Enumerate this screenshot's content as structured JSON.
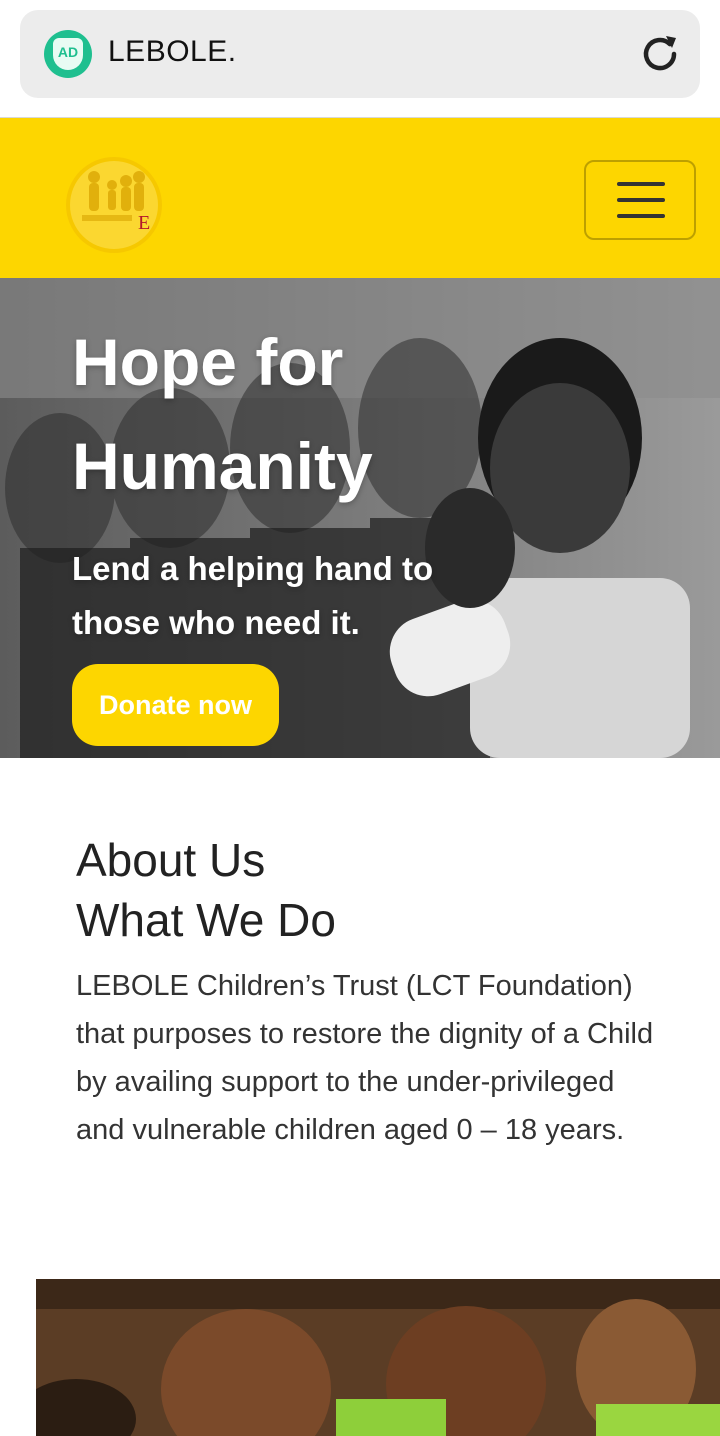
{
  "browser": {
    "url": "LEBOLE.",
    "adblock_label": "AD",
    "adblock_icon": "adblock-shield-icon",
    "reload_icon": "reload-icon"
  },
  "header": {
    "logo_letter": "E",
    "menu_icon": "hamburger-menu-icon",
    "background": "#fdd600"
  },
  "hero": {
    "title": "Hope for Humanity",
    "subtitle": "Lend a helping hand to those who need it.",
    "donate_label": "Donate now"
  },
  "about": {
    "heading_line1": "About Us",
    "heading_line2": "What We Do",
    "body": "LEBOLE Children’s Trust (LCT Foundation) that purposes to restore the dignity of a Child by availing support to the under-privileged and vulnerable children aged 0 – 18 years."
  },
  "colors": {
    "accent": "#fdd600",
    "adblock": "#1fbf8f"
  }
}
